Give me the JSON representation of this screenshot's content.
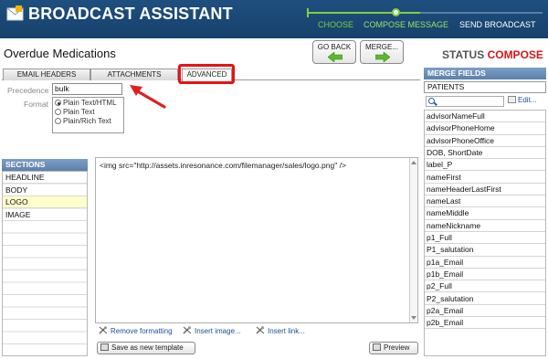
{
  "app": {
    "title": "BROADCAST ASSISTANT"
  },
  "steps": [
    {
      "label": "CHOOSE",
      "state": "done"
    },
    {
      "label": "COMPOSE MESSAGE",
      "state": "current"
    },
    {
      "label": "SEND BROADCAST",
      "state": "todo"
    }
  ],
  "page": {
    "title": "Overdue Medications"
  },
  "nav": {
    "back_label": "GO BACK",
    "merge_label": "MERGE..."
  },
  "status": {
    "key": "STATUS",
    "value": "COMPOSE"
  },
  "tabs": [
    {
      "label": "EMAIL HEADERS",
      "active": false
    },
    {
      "label": "ATTACHMENTS",
      "active": false
    },
    {
      "label": "ADVANCED",
      "active": true
    }
  ],
  "advanced": {
    "precedence_label": "Precedence",
    "precedence_value": "bulk",
    "format_label": "Format",
    "format_options": [
      {
        "label": "Plain Text/HTML",
        "selected": true
      },
      {
        "label": "Plain Text",
        "selected": false
      },
      {
        "label": "Plain/Rich Text",
        "selected": false
      }
    ]
  },
  "sections": {
    "header": "SECTIONS",
    "items": [
      {
        "label": "HEADLINE",
        "selected": false
      },
      {
        "label": "BODY",
        "selected": false
      },
      {
        "label": "LOGO",
        "selected": true
      },
      {
        "label": "IMAGE",
        "selected": false
      }
    ]
  },
  "editor": {
    "content": "<img src=\"http://assets.inresonance.com/filemanager/sales/logo.png\" />",
    "remove_formatting": "Remove formatting",
    "insert_image": "Insert image...",
    "insert_link": "Insert link...",
    "save_template": "Save as new template",
    "preview": "Preview"
  },
  "merge_fields": {
    "header": "MERGE FIELDS",
    "source": "PATIENTS",
    "search_placeholder": "",
    "edit_label": "Edit...",
    "items": [
      "advisorNameFull",
      "advisorPhoneHome",
      "advisorPhoneOffice",
      "DOB, ShortDate",
      "label_P",
      "nameFirst",
      "nameHeaderLastFirst",
      "nameLast",
      "nameMiddle",
      "nameNickname",
      "p1_Full",
      "P1_salutation",
      "p1a_Email",
      "p1b_Email",
      "p2_Full",
      "P2_salutation",
      "p2a_Email",
      "p2b_Email"
    ]
  },
  "colors": {
    "header_bg": "#1a4876",
    "step_done": "#7fd13b",
    "status_value": "#d01818",
    "highlight": "#e81212"
  }
}
